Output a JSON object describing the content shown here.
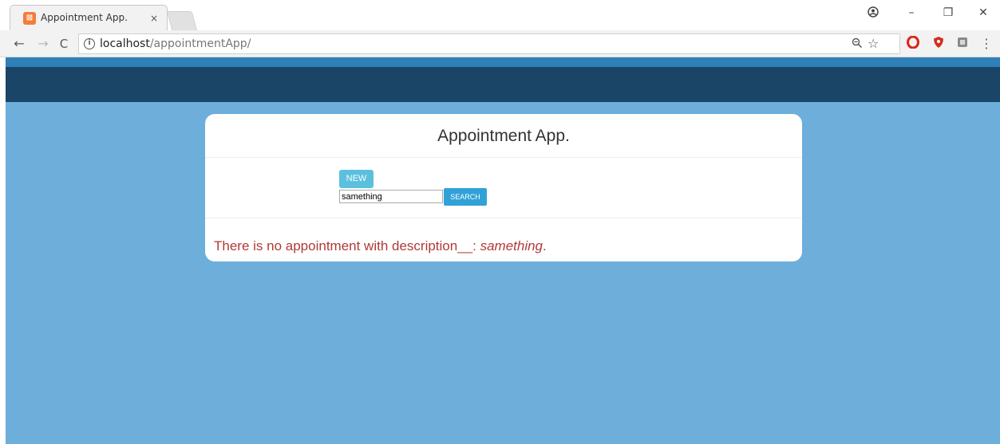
{
  "browser": {
    "tab_title": "Appointment App.",
    "tab_close": "×",
    "url_host": "localhost",
    "url_path": "/appointmentApp/",
    "window_controls": {
      "account": "account-icon",
      "minimize": "–",
      "restore": "❐",
      "close": "✕"
    },
    "nav": {
      "back": "←",
      "forward": "→",
      "reload": "C"
    },
    "omnibox_icons": [
      "zoom-icon",
      "star-icon"
    ],
    "extensions": [
      "opera-icon",
      "shield-icon",
      "extension-icon"
    ],
    "menu": "⋮"
  },
  "colors": {
    "page_background": "#6daedb",
    "navbar": "#1a4566",
    "top_band": "#2f7fb8",
    "new_button": "#5bc0de",
    "search_button": "#31a2d7",
    "message_text": "#b03a36"
  },
  "app": {
    "title": "Appointment App.",
    "new_button_label": "NEW",
    "search": {
      "value": "samething",
      "button_label": "SEARCH"
    },
    "message": {
      "prefix": "There is no appointment with description__: ",
      "term": "samething",
      "suffix": "."
    }
  }
}
